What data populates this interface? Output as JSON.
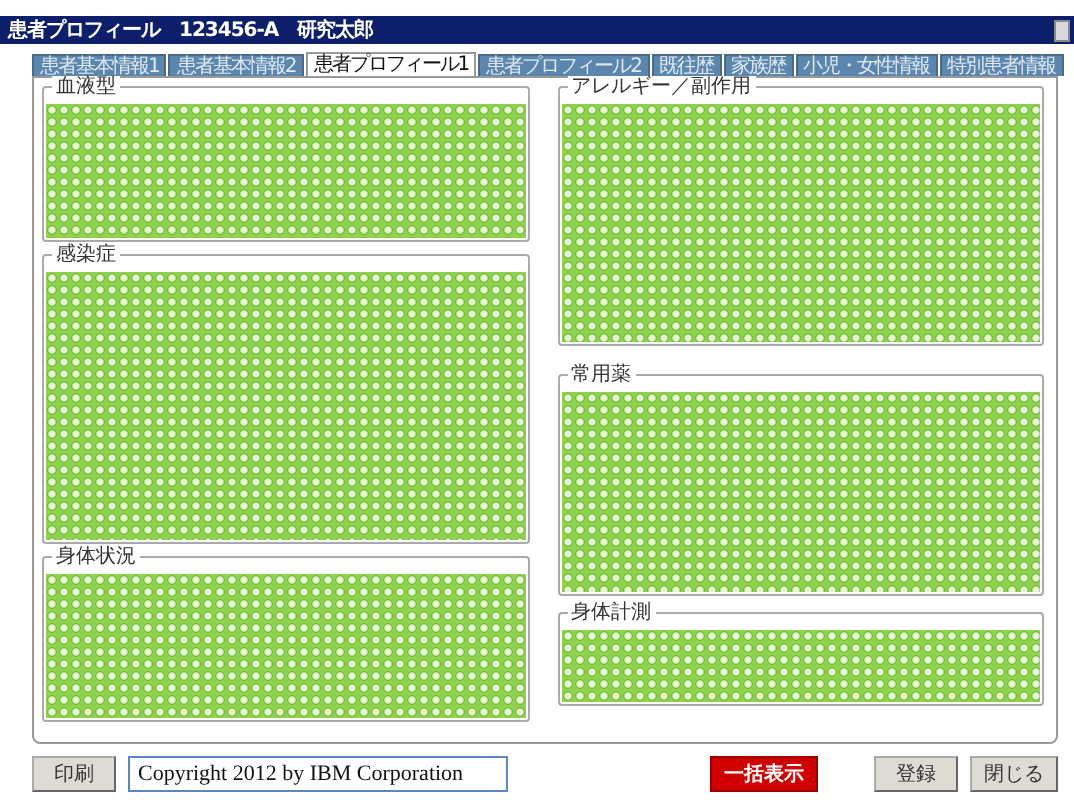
{
  "window": {
    "title": "患者プロフィール　123456-A　研究太郎"
  },
  "tabs": [
    {
      "label": "患者基本情報1",
      "selected": false
    },
    {
      "label": "患者基本情報2",
      "selected": false
    },
    {
      "label": "患者プロフィール1",
      "selected": true
    },
    {
      "label": "患者プロフィール2",
      "selected": false
    },
    {
      "label": "既往歴",
      "selected": false
    },
    {
      "label": "家族歴",
      "selected": false
    },
    {
      "label": "小児・女性情報",
      "selected": false
    },
    {
      "label": "特別患者情報",
      "selected": false
    }
  ],
  "left_sections": [
    {
      "label": "血液型"
    },
    {
      "label": "感染症"
    },
    {
      "label": "身体状況"
    }
  ],
  "right_sections": [
    {
      "label": "アレルギー／副作用"
    },
    {
      "label": "常用薬"
    },
    {
      "label": "身体計測"
    }
  ],
  "footer": {
    "print_button": "印刷",
    "copyright": "Copyright 2012 by IBM Corporation",
    "buttons": [
      {
        "label": "一括表示",
        "kind": "danger"
      },
      {
        "label": "登録",
        "kind": "normal"
      },
      {
        "label": "閉じる",
        "kind": "normal"
      }
    ]
  }
}
